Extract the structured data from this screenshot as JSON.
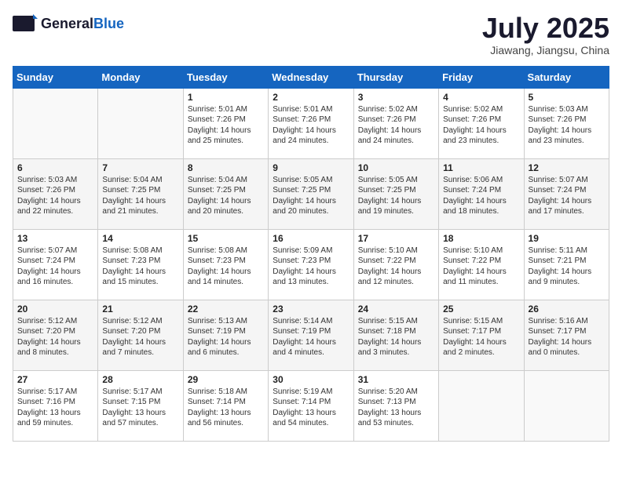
{
  "header": {
    "logo_general": "General",
    "logo_blue": "Blue",
    "month": "July 2025",
    "location": "Jiawang, Jiangsu, China"
  },
  "columns": [
    "Sunday",
    "Monday",
    "Tuesday",
    "Wednesday",
    "Thursday",
    "Friday",
    "Saturday"
  ],
  "weeks": [
    [
      {
        "day": "",
        "info": ""
      },
      {
        "day": "",
        "info": ""
      },
      {
        "day": "1",
        "info": "Sunrise: 5:01 AM\nSunset: 7:26 PM\nDaylight: 14 hours and 25 minutes."
      },
      {
        "day": "2",
        "info": "Sunrise: 5:01 AM\nSunset: 7:26 PM\nDaylight: 14 hours and 24 minutes."
      },
      {
        "day": "3",
        "info": "Sunrise: 5:02 AM\nSunset: 7:26 PM\nDaylight: 14 hours and 24 minutes."
      },
      {
        "day": "4",
        "info": "Sunrise: 5:02 AM\nSunset: 7:26 PM\nDaylight: 14 hours and 23 minutes."
      },
      {
        "day": "5",
        "info": "Sunrise: 5:03 AM\nSunset: 7:26 PM\nDaylight: 14 hours and 23 minutes."
      }
    ],
    [
      {
        "day": "6",
        "info": "Sunrise: 5:03 AM\nSunset: 7:26 PM\nDaylight: 14 hours and 22 minutes."
      },
      {
        "day": "7",
        "info": "Sunrise: 5:04 AM\nSunset: 7:25 PM\nDaylight: 14 hours and 21 minutes."
      },
      {
        "day": "8",
        "info": "Sunrise: 5:04 AM\nSunset: 7:25 PM\nDaylight: 14 hours and 20 minutes."
      },
      {
        "day": "9",
        "info": "Sunrise: 5:05 AM\nSunset: 7:25 PM\nDaylight: 14 hours and 20 minutes."
      },
      {
        "day": "10",
        "info": "Sunrise: 5:05 AM\nSunset: 7:25 PM\nDaylight: 14 hours and 19 minutes."
      },
      {
        "day": "11",
        "info": "Sunrise: 5:06 AM\nSunset: 7:24 PM\nDaylight: 14 hours and 18 minutes."
      },
      {
        "day": "12",
        "info": "Sunrise: 5:07 AM\nSunset: 7:24 PM\nDaylight: 14 hours and 17 minutes."
      }
    ],
    [
      {
        "day": "13",
        "info": "Sunrise: 5:07 AM\nSunset: 7:24 PM\nDaylight: 14 hours and 16 minutes."
      },
      {
        "day": "14",
        "info": "Sunrise: 5:08 AM\nSunset: 7:23 PM\nDaylight: 14 hours and 15 minutes."
      },
      {
        "day": "15",
        "info": "Sunrise: 5:08 AM\nSunset: 7:23 PM\nDaylight: 14 hours and 14 minutes."
      },
      {
        "day": "16",
        "info": "Sunrise: 5:09 AM\nSunset: 7:23 PM\nDaylight: 14 hours and 13 minutes."
      },
      {
        "day": "17",
        "info": "Sunrise: 5:10 AM\nSunset: 7:22 PM\nDaylight: 14 hours and 12 minutes."
      },
      {
        "day": "18",
        "info": "Sunrise: 5:10 AM\nSunset: 7:22 PM\nDaylight: 14 hours and 11 minutes."
      },
      {
        "day": "19",
        "info": "Sunrise: 5:11 AM\nSunset: 7:21 PM\nDaylight: 14 hours and 9 minutes."
      }
    ],
    [
      {
        "day": "20",
        "info": "Sunrise: 5:12 AM\nSunset: 7:20 PM\nDaylight: 14 hours and 8 minutes."
      },
      {
        "day": "21",
        "info": "Sunrise: 5:12 AM\nSunset: 7:20 PM\nDaylight: 14 hours and 7 minutes."
      },
      {
        "day": "22",
        "info": "Sunrise: 5:13 AM\nSunset: 7:19 PM\nDaylight: 14 hours and 6 minutes."
      },
      {
        "day": "23",
        "info": "Sunrise: 5:14 AM\nSunset: 7:19 PM\nDaylight: 14 hours and 4 minutes."
      },
      {
        "day": "24",
        "info": "Sunrise: 5:15 AM\nSunset: 7:18 PM\nDaylight: 14 hours and 3 minutes."
      },
      {
        "day": "25",
        "info": "Sunrise: 5:15 AM\nSunset: 7:17 PM\nDaylight: 14 hours and 2 minutes."
      },
      {
        "day": "26",
        "info": "Sunrise: 5:16 AM\nSunset: 7:17 PM\nDaylight: 14 hours and 0 minutes."
      }
    ],
    [
      {
        "day": "27",
        "info": "Sunrise: 5:17 AM\nSunset: 7:16 PM\nDaylight: 13 hours and 59 minutes."
      },
      {
        "day": "28",
        "info": "Sunrise: 5:17 AM\nSunset: 7:15 PM\nDaylight: 13 hours and 57 minutes."
      },
      {
        "day": "29",
        "info": "Sunrise: 5:18 AM\nSunset: 7:14 PM\nDaylight: 13 hours and 56 minutes."
      },
      {
        "day": "30",
        "info": "Sunrise: 5:19 AM\nSunset: 7:14 PM\nDaylight: 13 hours and 54 minutes."
      },
      {
        "day": "31",
        "info": "Sunrise: 5:20 AM\nSunset: 7:13 PM\nDaylight: 13 hours and 53 minutes."
      },
      {
        "day": "",
        "info": ""
      },
      {
        "day": "",
        "info": ""
      }
    ]
  ]
}
